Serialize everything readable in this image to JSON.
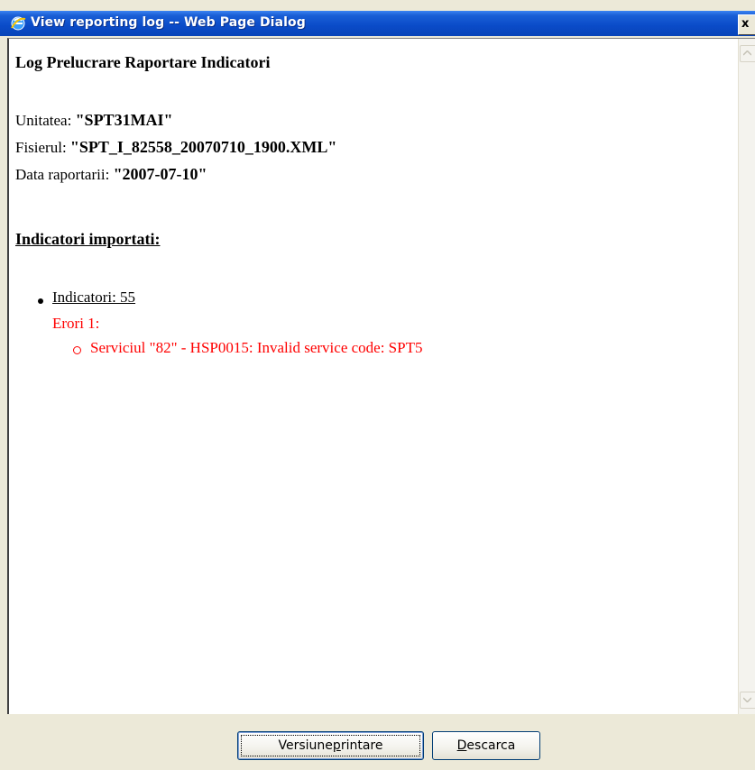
{
  "window": {
    "title": "View reporting log -- Web Page Dialog",
    "close_label": "x",
    "icon": "ie-icon"
  },
  "report": {
    "title": "Log Prelucrare Raportare Indicatori",
    "unitatea_label": "Unitatea: ",
    "unitatea_value": "\"SPT31MAI\"",
    "fisierul_label": "Fisierul: ",
    "fisierul_value": "\"SPT_I_82558_20070710_1900.XML\"",
    "data_label": "Data raportarii: ",
    "data_value": "\"2007-07-10\"",
    "section_heading": "Indicatori importati:",
    "indicatori": "Indicatori: 55",
    "errors_label": "Erori 1:",
    "errors": [
      "Serviciul \"82\" - HSP0015: Invalid service code: SPT5"
    ]
  },
  "buttons": {
    "print_prefix": "Versiune ",
    "print_accel": "p",
    "print_suffix": "rintare",
    "download_accel": "D",
    "download_suffix": "escarca"
  },
  "colors": {
    "error": "#ff0000",
    "titlebar": "#0a4bc8"
  }
}
